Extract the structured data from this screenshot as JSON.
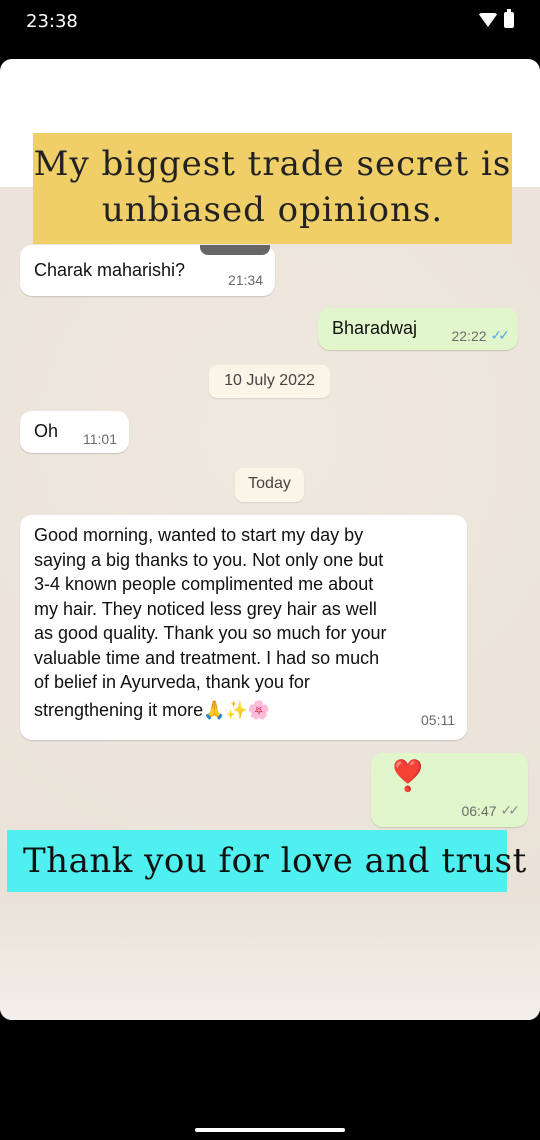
{
  "status_bar": {
    "time": "23:38"
  },
  "banners": {
    "top_line1": "My biggest trade secret is",
    "top_line2": "unbiased opinions.",
    "bottom": "Thank you for love and trust"
  },
  "messages": [
    {
      "direction": "in",
      "text": "Charak maharishi?",
      "time": "21:34"
    },
    {
      "direction": "out",
      "text": "Bharadwaj",
      "time": "22:22",
      "ticks": "read"
    },
    {
      "direction": "in",
      "text": "Oh",
      "time": "11:01"
    },
    {
      "direction": "in",
      "lines": [
        "Good morning, wanted to start my day by",
        "saying a big thanks to you. Not only one but",
        "3-4 known people complimented me about",
        "my hair. They noticed less grey hair as well",
        "as good quality. Thank you so much for your",
        "valuable time and treatment. I had so much",
        "of belief in Ayurveda, thank you for",
        "strengthening it more🙏✨🌸"
      ],
      "time": "05:11"
    },
    {
      "direction": "out",
      "text": "❣️",
      "time": "06:47",
      "ticks": "delivered"
    }
  ],
  "date_chips": [
    "10 July 2022",
    "Today"
  ],
  "colors": {
    "outgoing_bubble": "#e1f7cb",
    "incoming_bubble": "#ffffff",
    "top_banner": "#f0cf69",
    "bottom_banner": "#4ff0ef",
    "read_ticks": "#4aa8e6"
  }
}
